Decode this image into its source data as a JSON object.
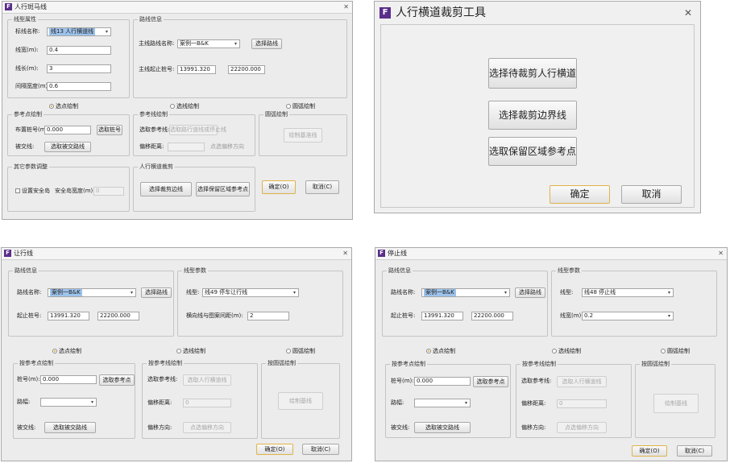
{
  "w1": {
    "title": "人行斑马线",
    "g_linetype": "线型属性",
    "lbl_name": "标线名称:",
    "name_val": "线13 人行横道线",
    "lbl_width": "线宽(m):",
    "width_val": "0.4",
    "lbl_len": "线长(m):",
    "len_val": "3",
    "lbl_gap": "间隔宽度(m):",
    "gap_val": "0.6",
    "g_road": "路线信息",
    "lbl_main": "主线路线名称:",
    "main_val": "案例一B&K",
    "btn_select_route": "选择路线",
    "lbl_range": "主线起止桩号:",
    "start_val": "13991.320",
    "end_val": "22200.000",
    "r_point": "选点绘制",
    "r_line": "选线绘制",
    "r_circle": "圆弧绘制",
    "g_refpt": "参考点绘制",
    "lbl_station": "布置桩号(m):",
    "station_val": "0.000",
    "btn_pick_station": "选取桩号",
    "lbl_cross": "被交线:",
    "btn_pick_cross": "选取被交路线",
    "g_refline": "参考线绘制",
    "lbl_refline": "选取参考线:",
    "btn_refline": "选取路行道线或停止线",
    "lbl_offset": "偏移距离:",
    "btn_offset_dir": "点选偏移方向",
    "g_circle": "圆弧绘制",
    "btn_draw_base": "绘制基准线",
    "g_other": "其它参数调整",
    "chk_island": "设置安全岛",
    "lbl_island": "安全岛宽度(m):",
    "island_val": "0",
    "g_trim": "人行横道裁剪",
    "btn_trim_border": "选择裁剪边线",
    "btn_keep_ref": "选择保留区域参考点",
    "ok": "确定(O)",
    "cancel": "取消(C)"
  },
  "w2": {
    "title": "人行横道裁剪工具",
    "btn1": "选择待裁剪人行横道",
    "btn2": "选择裁剪边界线",
    "btn3": "选取保留区域参考点",
    "ok": "确定",
    "cancel": "取消"
  },
  "w3": {
    "title": "让行线",
    "g_road": "路线信息",
    "lbl_route": "路线名称:",
    "route_val": "案例一B&K",
    "btn_select_route": "选择路线",
    "lbl_start": "起止桩号:",
    "start_val": "13991.320",
    "end_val": "22200.000",
    "g_type": "线型参数",
    "lbl_type": "线型:",
    "type_val": "线49 停车让行线",
    "lbl_spacing": "横向线与图案间距(m):",
    "spacing_val": "2",
    "r_point": "选点绘制",
    "r_line": "选线绘制",
    "r_circle": "圆弧绘制",
    "g_refpt": "按参考点绘制",
    "lbl_station": "桩号(m):",
    "station_val": "0.000",
    "btn_pick_ref": "选取参考点",
    "lbl_lane": "路幅:",
    "lbl_cross": "被交线:",
    "btn_pick_cross": "选取被交路线",
    "g_refline": "按参考线绘制",
    "lbl_refline": "选取参考线:",
    "btn_refline": "选取人行横道线",
    "lbl_offset": "偏移距离:",
    "offset_val": "0",
    "lbl_dir": "偏移方向:",
    "btn_dir": "点选偏移方向",
    "g_circle": "按圆弧绘制",
    "btn_draw_base": "绘制基线",
    "ok": "确定(O)",
    "cancel": "取消(C)"
  },
  "w4": {
    "title": "停止线",
    "g_road": "路线信息",
    "lbl_route": "路线名称:",
    "route_val": "案例一B&K",
    "btn_select_route": "选择路线",
    "lbl_start": "起止桩号:",
    "start_val": "13991.320",
    "end_val": "22200.000",
    "g_type": "线型参数",
    "lbl_type": "线型:",
    "type_val": "线48 停止线",
    "lbl_width": "线宽(m):",
    "width_val": "0.2",
    "r_point": "选点绘制",
    "r_line": "选线绘制",
    "r_circle": "圆弧绘制",
    "g_refpt": "按参考点绘制",
    "lbl_station": "桩号(m):",
    "station_val": "0.000",
    "btn_pick_ref": "选取参考点",
    "lbl_lane": "路幅:",
    "lbl_cross": "被交线:",
    "btn_pick_cross": "选取被交路线",
    "g_refline": "按参考线绘制",
    "lbl_refline": "选取参考线:",
    "btn_refline": "选取人行横道线",
    "lbl_offset": "偏移距离:",
    "offset_val": "0",
    "lbl_dir": "偏移方向:",
    "btn_dir": "点选偏移方向",
    "g_circle": "按圆弧绘制",
    "btn_draw_base": "绘制基线",
    "ok": "确定(O)",
    "cancel": "取消(C)"
  },
  "icons": {
    "app": "F",
    "close": "✕",
    "dropdown": "▾"
  },
  "colors": {
    "app_icon": "#5a2e8a",
    "selection": "#9dc3ec",
    "default_button_border": "#e0b34a"
  }
}
